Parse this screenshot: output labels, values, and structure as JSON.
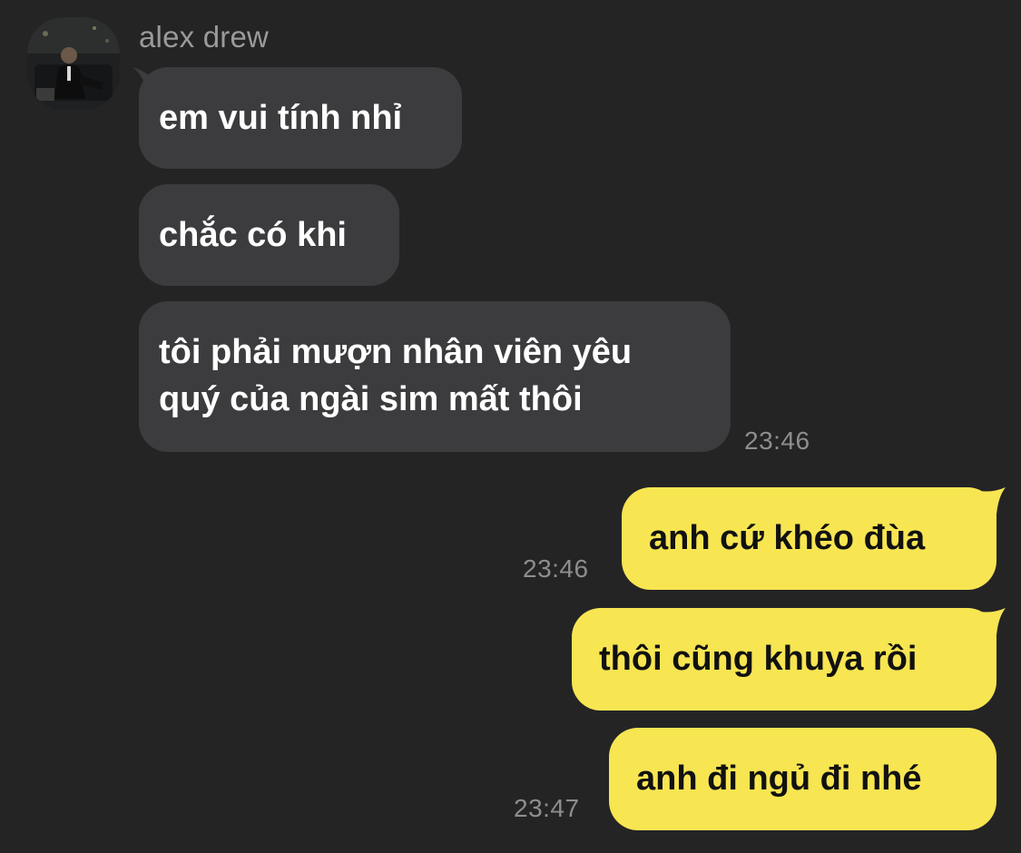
{
  "chat": {
    "sender": {
      "name": "alex drew"
    },
    "incoming": [
      {
        "text": "em vui tính nhỉ"
      },
      {
        "text": "chắc có khi"
      },
      {
        "line1": "tôi phải mượn nhân viên yêu",
        "line2": "quý của ngài sim mất thôi",
        "time": "23:46"
      }
    ],
    "outgoing": [
      {
        "text": "anh cứ khéo đùa",
        "time": "23:46"
      },
      {
        "text": "thôi cũng khuya rồi"
      },
      {
        "text": "anh đi ngủ đi nhé",
        "time": "23:47"
      }
    ],
    "colors": {
      "background": "#242425",
      "incoming_bubble": "#3c3c3e",
      "outgoing_bubble": "#f7e552",
      "sender_name": "#9a9a9c",
      "timestamp": "#8e8e90"
    }
  }
}
